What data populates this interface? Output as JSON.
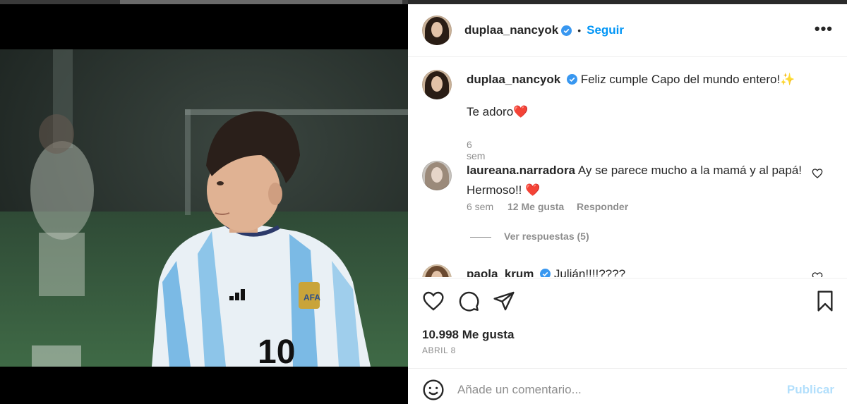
{
  "post": {
    "author": "duplaa_nancyok",
    "follow_label": "Seguir",
    "dot": "•",
    "more_label": "•••"
  },
  "caption": {
    "author": "duplaa_nancyok",
    "text_line1": "Feliz cumple Capo del mundo entero!✨",
    "text_line2": "Te adoro❤️",
    "time": "6 sem"
  },
  "comments": [
    {
      "author": "laureana.narradora",
      "text": "Ay se parece mucho a la mamá y al papá! Hermoso!! ❤️",
      "time": "6 sem",
      "likes": "12 Me gusta",
      "reply_label": "Responder",
      "view_replies": "Ver respuestas (5)"
    },
    {
      "author": "paola_krum",
      "text": "Julián!!!!????"
    }
  ],
  "stats": {
    "likes": "10.998 Me gusta",
    "date": "ABRIL 8"
  },
  "composer": {
    "placeholder": "Añade un comentario...",
    "publish_label": "Publicar"
  },
  "photo": {
    "jersey_number": "10"
  },
  "colors": {
    "accent": "#0095f6",
    "verified": "#3897f0",
    "like_red": "#ed4956",
    "publish_disabled": "#b2dffc"
  }
}
